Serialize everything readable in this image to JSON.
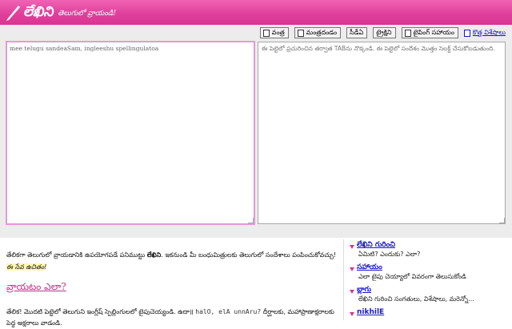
{
  "header": {
    "brand_name": "లేఖిని",
    "tagline": "తెలుగులో వ్రాయండి!"
  },
  "toolbar": {
    "buttons": [
      {
        "label": "వంత్ర"
      },
      {
        "label": "మంత్రదండం"
      },
      {
        "label": "సీడీఏ"
      },
      {
        "label": "ట్రైక్షిని"
      },
      {
        "label": "టైపింగ్ సహాయం"
      }
    ],
    "new_features_label": "కొత్త విశేషాలు"
  },
  "editor": {
    "input_value": "mee telugu sandeaSam, ingleeshu spellingulatoa",
    "output_hint": "ఈ పెట్టెలో ప్రచురించిన తర్వాత TABను నొక్కండి. ఈ పెట్టెలో సందేశం మొత్తం సెలక్ట్ చేసుకోబడుతుంది."
  },
  "main": {
    "intro_start": "తేలికగా తెలుగులో వ్రాయడానికి ఉపయోగపడే పనిముట్టు ",
    "intro_brand": "లేఖిని",
    "intro_end": ". ఇకనుండి మీ బంధుమిత్రులకు తెలుగులో సందేశాలు పంపించుకోవచ్చు!",
    "free_note": "ఈ సేవ ఉచితం!",
    "how_title": "వ్రాయటం ఎలా?",
    "how_text_start": "తేలిక! మొదటి పెట్టెలో తెలుగుని ఇంగ్లీష్ స్పెల్లింగులలో టైపుచెయ్యండి. ఉదా॥",
    "how_example": "halO, elA unnAru?",
    "how_text_end": "దీర్ఘాలకు, మహాప్రాణాక్షరాలకు పెద్ద అక్షరాలు వాడండి."
  },
  "sidebar": {
    "items": [
      {
        "title": "లేఖిని గురించి",
        "desc": "ఏమిటి? ఎందుకు? ఎలా?"
      },
      {
        "title": "సహాయం",
        "desc": "ఎలా టైపు చెయ్యాలో వివరంగా తెలుసుకోండి"
      },
      {
        "title": "బ్లాగు",
        "desc": "లేఖిని గురించి సంగతులు, విశేషాలు, మరెన్నో..."
      },
      {
        "title": "nikhilE",
        "desc": ""
      }
    ]
  },
  "colors": {
    "header_pink": "#e0409c",
    "link_blue": "#1818c8",
    "accent_pink": "#cc2a8a"
  }
}
